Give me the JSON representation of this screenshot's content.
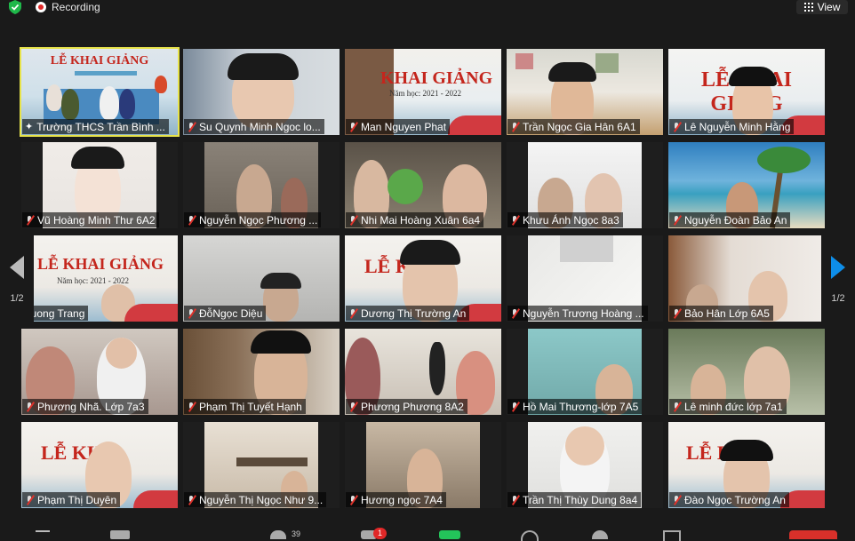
{
  "topbar": {
    "recording_label": "Recording",
    "view_label": "View"
  },
  "pagination": {
    "left_label": "1/2",
    "right_label": "1/2"
  },
  "toolbar": {
    "participants_count": "39",
    "chat_badge": "1"
  },
  "banner_text": {
    "khai_giang": "LỄ KHAI GIẢNG",
    "khai_giang_short": "KHAI GIẢNG",
    "le_khai_giang_partial": "LỄ KH",
    "le_kh2": "LỄ KHAI GIẢNG",
    "le_kh3": "LỄ KHA",
    "le_kh4": "LỄ KHAI",
    "nam_hoc": "Năm học: 2021 - 2022"
  },
  "participants": [
    {
      "name": "Trường THCS Trần Bình ...",
      "muted": false
    },
    {
      "name": "Su Quynh Minh Ngoc lo...",
      "muted": true
    },
    {
      "name": "Man Nguyen Phat",
      "muted": true
    },
    {
      "name": "Trần Ngọc Gia Hân 6A1",
      "muted": true
    },
    {
      "name": "Lê Nguyễn Minh Hằng",
      "muted": true
    },
    {
      "name": "Vũ Hoàng Minh Thư 6A2",
      "muted": true
    },
    {
      "name": "Nguyễn Ngọc Phương ...",
      "muted": true
    },
    {
      "name": "Nhi Mai Hoàng Xuân 6a4",
      "muted": true
    },
    {
      "name": "Khưu Ánh Ngọc 8a3",
      "muted": true
    },
    {
      "name": "Nguyễn Đoàn Bảo An",
      "muted": true
    },
    {
      "name": "huong Trang",
      "muted": false
    },
    {
      "name": "ĐỗNgọc Diệu",
      "muted": true
    },
    {
      "name": "Dương Thị Trường An",
      "muted": true
    },
    {
      "name": "Nguyễn Trương Hoàng ...",
      "muted": true
    },
    {
      "name": "Bảo Hân Lớp 6A5",
      "muted": true
    },
    {
      "name": "Phương Nhã. Lớp 7a3",
      "muted": true
    },
    {
      "name": "Phạm Thị Tuyết Hạnh",
      "muted": true
    },
    {
      "name": "Phương Phương 8A2",
      "muted": true
    },
    {
      "name": "Hồ Mai Thương-lớp 7A5",
      "muted": true
    },
    {
      "name": "Lê minh đức lớp 7a1",
      "muted": true
    },
    {
      "name": "Phạm Thị Duyên",
      "muted": true
    },
    {
      "name": "Nguyễn Thị Ngọc Như 9...",
      "muted": true
    },
    {
      "name": "Hương ngọc 7A4",
      "muted": true
    },
    {
      "name": "Trần Thị Thùy Dung 8a4",
      "muted": true
    },
    {
      "name": "Đào Ngọc Trường An",
      "muted": true
    }
  ]
}
